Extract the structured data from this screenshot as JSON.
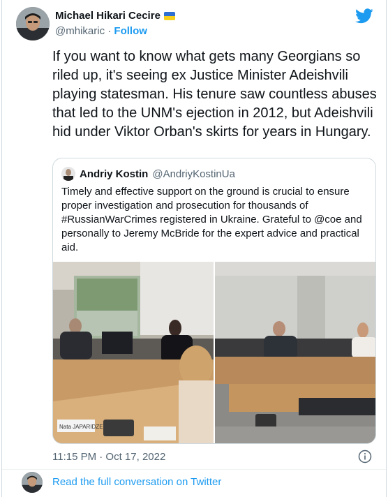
{
  "author": {
    "name": "Michael Hikari Cecire",
    "handle": "@mhikaric",
    "separator": "·",
    "follow_label": "Follow",
    "flag_icon": "ukraine-flag-icon"
  },
  "tweet": {
    "text": "If you want to know what gets many Georgians so riled up, it's seeing ex Justice Minister Adeishvili playing statesman. His tenure saw countless abuses that led to the UNM's ejection in 2012, but Adeishvili hid under Viktor Orban's skirts for years in Hungary."
  },
  "quoted": {
    "name": "Andriy Kostin",
    "handle": "@AndriyKostinUa",
    "text": "Timely and effective support on the ground is crucial to ensure proper investigation and prosecution for thousands of #RussianWarCrimes registered in Ukraine. Grateful to @coe and personally to Jeremy McBride for the expert advice and practical aid.",
    "photo_left_placard": "Nata JAPARIDZE"
  },
  "meta": {
    "timestamp": "11:15 PM · Oct 17, 2022"
  },
  "footer": {
    "read_more": "Read the full conversation on Twitter"
  },
  "colors": {
    "accent": "#1d9bf0",
    "text": "#0f1419",
    "muted": "#536471",
    "border": "#cfd9de"
  }
}
